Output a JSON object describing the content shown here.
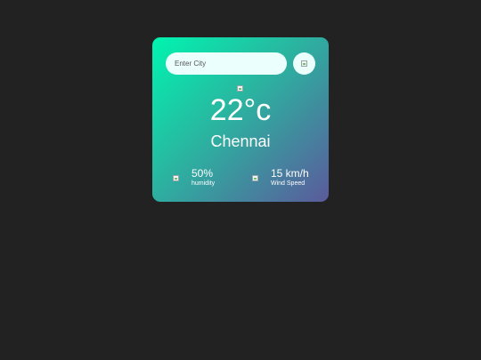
{
  "search": {
    "placeholder": "Enter City",
    "value": "",
    "button_icon": "search-icon"
  },
  "weather": {
    "icon": "weather-condition-icon",
    "temperature": "22°c",
    "city": "Chennai"
  },
  "details": {
    "humidity": {
      "icon": "humidity-icon",
      "value": "50%",
      "label": "humidity"
    },
    "wind": {
      "icon": "wind-icon",
      "value": "15 km/h",
      "label": "Wind Speed"
    }
  },
  "colors": {
    "background": "#222222",
    "card_gradient_start": "#00f5b0",
    "card_gradient_end": "#5b5a9c",
    "input_bg": "#ebfffc",
    "text": "#ffffff"
  }
}
